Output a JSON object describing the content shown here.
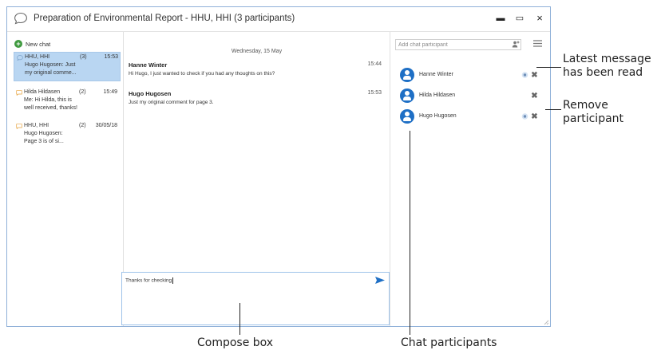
{
  "window": {
    "title": "Preparation of Environmental Report  - HHU, HHI (3 participants)",
    "minimize": "▬",
    "maximize": "▭",
    "close": "×"
  },
  "sidebar": {
    "new_chat_label": "New chat",
    "conversations": [
      {
        "name": "HHU, HHI",
        "count": "(3)",
        "time": "15:53",
        "lines": [
          "Hugo Hugosen: Just",
          "my original comme..."
        ],
        "active": true
      },
      {
        "name": "Hilda Hildasen",
        "count": "(2)",
        "time": "15:49",
        "lines": [
          "Me: Hi Hilda, this is",
          "well received, thanks!"
        ],
        "active": false
      },
      {
        "name": "HHU, HHI",
        "count": "(2)",
        "time": "30/05/18",
        "lines": [
          "Hugo Hugosen:",
          "Page 3 is of si..."
        ],
        "active": false
      }
    ]
  },
  "messages": {
    "date": "Wednesday, 15 May",
    "items": [
      {
        "sender": "Hanne Winter",
        "time": "15:44",
        "text": "Hi Hugo, I just wanted to check if you had any thoughts on this?"
      },
      {
        "sender": "Hugo Hugosen",
        "time": "15:53",
        "text": "Just my original comment for page 3."
      }
    ]
  },
  "compose": {
    "text": "Thanks for checking"
  },
  "participants": {
    "placeholder": "Add chat participant",
    "list": [
      {
        "name": "Hanne Winter",
        "read": true
      },
      {
        "name": "Hilda Hildasen",
        "read": false
      },
      {
        "name": "Hugo Hugosen",
        "read": true
      }
    ]
  },
  "annotations": {
    "latest_read": [
      "Latest message",
      "has been read"
    ],
    "remove": [
      "Remove",
      "participant"
    ],
    "compose_box": "Compose box",
    "chat_participants": "Chat participants"
  },
  "colors": {
    "accent": "#1e6fc5",
    "selected_row": "#b9d6f2",
    "new_chat_green": "#3f9a3f",
    "window_border": "#8fb0d8"
  }
}
